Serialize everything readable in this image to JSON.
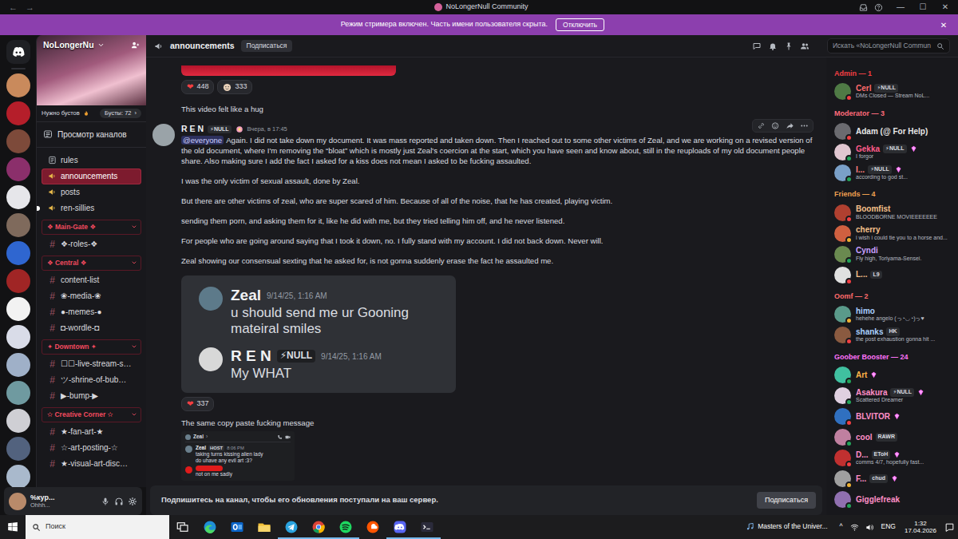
{
  "window": {
    "title": "NoLongerNull Community",
    "back": "←",
    "forward": "→",
    "minimize": "—",
    "maximize": "☐",
    "close": "✕"
  },
  "streamer_banner": {
    "text": "Режим стримера включен. Часть имени пользователя скрыта.",
    "button": "Отключить",
    "close": "✕"
  },
  "servers": [
    {
      "color": "#c98a5c"
    },
    {
      "color": "#b51e2a"
    },
    {
      "color": "#7d4a3a"
    },
    {
      "color": "#8b2f6b"
    },
    {
      "color": "#e6e6ea"
    },
    {
      "color": "#7f6a5c"
    },
    {
      "color": "#2f66d0"
    },
    {
      "color": "#a02525"
    },
    {
      "color": "#f2f2f2"
    },
    {
      "color": "#d9dce8"
    },
    {
      "color": "#9fb0c8"
    },
    {
      "color": "#6f9aa0"
    },
    {
      "color": "#cfcfd4"
    },
    {
      "color": "#52627e"
    },
    {
      "color": "#a9b9cc"
    },
    {
      "color": "#6d5a4b"
    }
  ],
  "server": {
    "name": "NoLongerNu",
    "boost_need": "Нужно бустов",
    "boosts": "Бусты: 72",
    "boosts_arrow": "›",
    "browse": "Просмотр каналов"
  },
  "channel_groups": [
    {
      "channels": [
        {
          "kind": "rules",
          "label": "rules",
          "selected": false,
          "unread": false
        },
        {
          "kind": "announcement",
          "label": "announcements",
          "selected": true,
          "unread": false
        },
        {
          "kind": "announcement",
          "label": "posts",
          "selected": false,
          "unread": false
        },
        {
          "kind": "announcement",
          "label": "ren-sillies",
          "selected": false,
          "unread": true
        }
      ]
    },
    {
      "category": "❖ Main-Gate ❖",
      "channels": [
        {
          "kind": "text",
          "hash": "#",
          "label": "❖-roles-❖",
          "selected": false,
          "unread": false
        }
      ]
    },
    {
      "category": "❖ Central ❖",
      "channels": [
        {
          "kind": "text",
          "hash": "#",
          "label": "content-list",
          "selected": false,
          "unread": false
        },
        {
          "kind": "text",
          "hash": "#",
          "label": "❀-media-❀",
          "selected": false,
          "unread": false
        },
        {
          "kind": "text",
          "hash": "#",
          "label": "●-memes-●",
          "selected": false,
          "unread": false
        },
        {
          "kind": "text",
          "hash": "#",
          "label": "◘-wordle-◘",
          "selected": false,
          "unread": false
        }
      ]
    },
    {
      "category": "✦ Downtown ✦",
      "channels": [
        {
          "kind": "text",
          "hash": "#",
          "label": "☐☐-live-stream-s…",
          "selected": false,
          "unread": false
        },
        {
          "kind": "text",
          "hash": "#",
          "label": "ツ-shrine-of-bub…",
          "selected": false,
          "unread": false
        },
        {
          "kind": "text",
          "hash": "#",
          "label": "▶-bump-▶",
          "selected": false,
          "unread": false
        }
      ]
    },
    {
      "category": "✫ Creative Corner ✫",
      "channels": [
        {
          "kind": "text",
          "hash": "#",
          "label": "★-fan-art-★",
          "selected": false,
          "unread": false
        },
        {
          "kind": "text",
          "hash": "#",
          "label": "☆-art-posting-☆",
          "selected": false,
          "unread": false
        },
        {
          "kind": "text",
          "hash": "#",
          "label": "★-visual-art-disc…",
          "selected": false,
          "unread": false
        }
      ]
    }
  ],
  "user": {
    "name": "%кур...",
    "status": "Ohhh...",
    "avatar": "#b98a6a"
  },
  "header": {
    "channel": "announcements",
    "follow": "Подписаться",
    "search": "Искать «NoLongerNull Commun"
  },
  "feed": {
    "previous": {
      "reactions": [
        {
          "kind": "heart",
          "emoji": "❤",
          "count": "448"
        },
        {
          "kind": "sticker",
          "count": "333"
        }
      ],
      "text": "This video felt like a hug"
    },
    "post": {
      "author": "R E N",
      "tag": "⚡NULL",
      "time": "Вчера, в 17:45",
      "avatar": "#9aa3a8",
      "mention": "@everyone",
      "paragraphs": [
        "Again. I did not take down my document. It was mass reported and taken down. Then I reached out to some other victims of Zeal, and we are working on a revised version of the old document, where I'm removing the “bloat” which is mostly just Zeal's coercion at the start, which you have seen and know about, still in the reuploads of my old document people share. Also making sure I add the fact I asked for a kiss does not mean I asked to be fucking assaulted.",
        "I was the only victim of sexual assault, done by Zeal.",
        "But there are other victims of zeal, who are super scared of him. Because of all of the noise, that he has created, playing victim.",
        "sending them porn, and asking them for it, like he did with me, but they tried telling him off, and he never listened.",
        "For people who are going around saying that I took it down, no. I fully stand with my account. I did not back down. Never will.",
        "Zeal showing our consensual sexting that he asked for, is not gonna suddenly erase the fact he assaulted me."
      ],
      "screenshot": {
        "messages": [
          {
            "author": "Zeal",
            "time": "9/14/25, 1:16 AM",
            "text": "u should send me ur Gooning mateiral smiles",
            "avatar": "#5d7a8a"
          },
          {
            "author": "R E N",
            "tag": "⚡NULL",
            "time": "9/14/25, 1:16 AM",
            "text": "My WHAT",
            "avatar": "#d8d8d8"
          }
        ]
      },
      "reactions": [
        {
          "kind": "heart",
          "emoji": "❤",
          "count": "337"
        }
      ],
      "followup": "The same copy paste fucking message",
      "screenshot2": {
        "title": "Zeal",
        "arrow": "›",
        "messages": [
          {
            "redacted": false,
            "author": "Zeal",
            "tag": "HOST",
            "time": "8:06 PM",
            "lines": [
              "taking turns kissing alien lady",
              "do uhave any evil art :3?"
            ]
          },
          {
            "redacted": true,
            "lines": [
              "not on me sadly"
            ]
          }
        ]
      }
    }
  },
  "members": [
    {
      "title": "Admin — 1",
      "color": "#f23f43",
      "members": [
        {
          "name": "Cerl",
          "color": "#ff6b6b",
          "avatar": "#4f7a45",
          "status": "#f23f43",
          "tag": "⚡NULL",
          "boost": false,
          "activity": "DMs Closed — Stream NoL..."
        }
      ]
    },
    {
      "title": "Moderator — 3",
      "color": "#ff6b7a",
      "members": [
        {
          "name": "Adam (@ For Help)",
          "color": "#e8e8e8",
          "avatar": "#6b6b70",
          "status": "#f23f43",
          "boost": false
        },
        {
          "name": "Gekka",
          "color": "#ff5c8a",
          "avatar": "#e0c6d0",
          "status": "#23a55a",
          "tag": "⚡NULL",
          "boost": true,
          "activity": "I forgor"
        },
        {
          "name": "I...",
          "color": "#ff8080",
          "avatar": "#7aa0c8",
          "status": "#23a55a",
          "tag": "⚡NULL",
          "boost": true,
          "activity": "according to god st..."
        }
      ]
    },
    {
      "title": "Friends — 4",
      "color": "#f0a050",
      "members": [
        {
          "name": "Boomfist",
          "color": "#f5c08a",
          "avatar": "#b04030",
          "status": "#f23f43",
          "boost": false,
          "activity": "BLOODBORNE MOVIEEEEEEE"
        },
        {
          "name": "cherry",
          "color": "#f5c08a",
          "avatar": "#d06040",
          "status": "#f0b232",
          "boost": false,
          "activity": "i wish i could tie you to a horse and..."
        },
        {
          "name": "Cyndi",
          "color": "#c9a0ff",
          "avatar": "#6a8a50",
          "status": "#23a55a",
          "boost": false,
          "activity": "Fly high, Toriyama-Sensei."
        },
        {
          "name": "L...",
          "color": "#f5c08a",
          "avatar": "#e0e0e0",
          "status": "#f23f43",
          "tag": "L9",
          "boost": false
        }
      ]
    },
    {
      "title": "Oomf — 2",
      "color": "#ff6b6b",
      "members": [
        {
          "name": "himo",
          "color": "#a8d0ff",
          "avatar": "#5a9a8a",
          "status": "#f0b232",
          "boost": false,
          "activity": "hehehe angelo (っ◔◡◔)っ♥"
        },
        {
          "name": "shanks",
          "color": "#a8d0ff",
          "avatar": "#8a5a40",
          "status": "#f23f43",
          "tag": "HK",
          "boost": false,
          "activity": "the post exhaustion gonna hit ..."
        }
      ]
    },
    {
      "title": "Goober Booster — 24",
      "color": "#ff73fa",
      "members": [
        {
          "name": "Art",
          "color": "#ffb347",
          "avatar": "#40c0a0",
          "status": "#23a55a",
          "boost": true
        },
        {
          "name": "Asakura",
          "color": "#ff8fc8",
          "avatar": "#e0d0e0",
          "status": "#23a55a",
          "tag": "⚡NULL",
          "boost": true,
          "activity": "Scattered Dreamer"
        },
        {
          "name": "BLVITOR",
          "color": "#ff8fc8",
          "avatar": "#3070c0",
          "status": "#f23f43",
          "boost": true
        },
        {
          "name": "cool",
          "color": "#ff8fc8",
          "avatar": "#c080a0",
          "status": "#23a55a",
          "tag": "RAWR",
          "boost": false
        },
        {
          "name": "D...",
          "color": "#ff8fc8",
          "avatar": "#c03030",
          "status": "#f23f43",
          "tag": "EToH",
          "boost": true,
          "activity": "comms 4/7, hopefully fast..."
        },
        {
          "name": "F...",
          "color": "#ff8fc8",
          "avatar": "#a0a0a0",
          "status": "#f0b232",
          "tag": "chud",
          "boost": true
        },
        {
          "name": "Gigglefreak",
          "color": "#ff8fc8",
          "avatar": "#9070b0",
          "status": "#23a55a",
          "boost": false
        }
      ]
    }
  ],
  "subscribe": {
    "text": "Подпишитесь на канал, чтобы его обновления поступали на ваш сервер.",
    "button": "Подписаться"
  },
  "taskbar": {
    "search": "Поиск",
    "apps": [
      {
        "kind": "taskview",
        "running": false
      },
      {
        "kind": "edge",
        "running": false
      },
      {
        "kind": "outlook",
        "running": false
      },
      {
        "kind": "explorer",
        "running": false
      },
      {
        "kind": "telegram",
        "running": true
      },
      {
        "kind": "chrome",
        "running": true
      },
      {
        "kind": "spotify",
        "running": true
      },
      {
        "kind": "soundcloud",
        "running": false
      },
      {
        "kind": "discord",
        "running": true
      },
      {
        "kind": "terminal",
        "running": true
      }
    ],
    "media": "Masters of the Univer...",
    "chevron": "^",
    "lang": "ENG",
    "time": "1:32",
    "date": "17.04.2026"
  }
}
